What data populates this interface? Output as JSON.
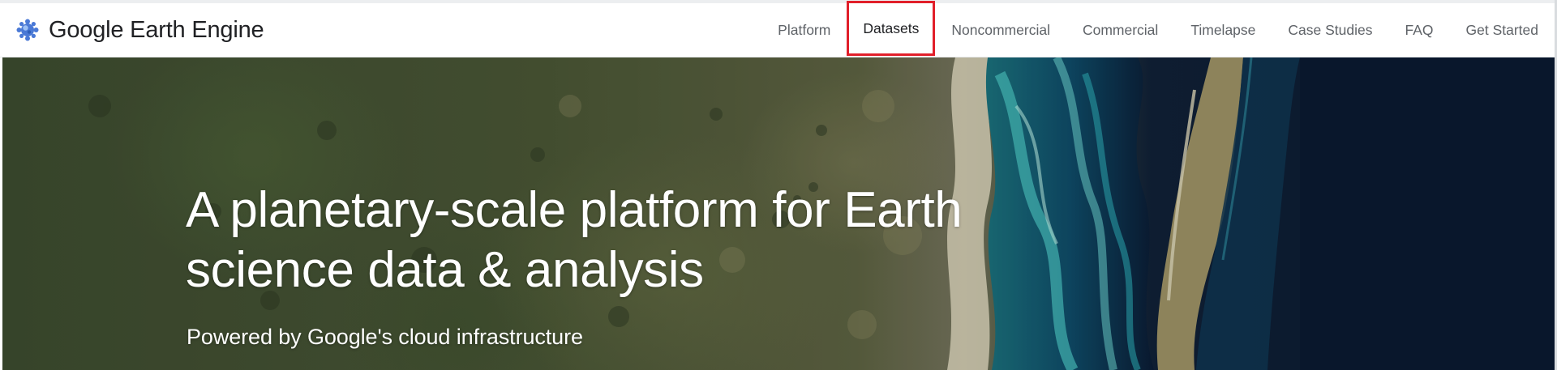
{
  "brand": {
    "name": "Google Earth Engine",
    "logo_icon": "earth-engine-logo-icon"
  },
  "nav": {
    "items": [
      {
        "label": "Platform",
        "active": false
      },
      {
        "label": "Datasets",
        "active": true
      },
      {
        "label": "Noncommercial",
        "active": false
      },
      {
        "label": "Commercial",
        "active": false
      },
      {
        "label": "Timelapse",
        "active": false
      },
      {
        "label": "Case Studies",
        "active": false
      },
      {
        "label": "FAQ",
        "active": false
      },
      {
        "label": "Get Started",
        "active": false
      }
    ],
    "highlight_color": "#e11f2a"
  },
  "hero": {
    "title_line1": "A planetary-scale platform for Earth",
    "title_line2": "science data & analysis",
    "subtitle": "Powered by Google's cloud infrastructure",
    "background": "satellite-imagery-coastline"
  },
  "colors": {
    "logo_blue": "#4a79d6",
    "nav_text": "#5f6368",
    "active_text": "#202124",
    "ocean": "#0b1a30",
    "lagoon": "#1e8a8e"
  }
}
